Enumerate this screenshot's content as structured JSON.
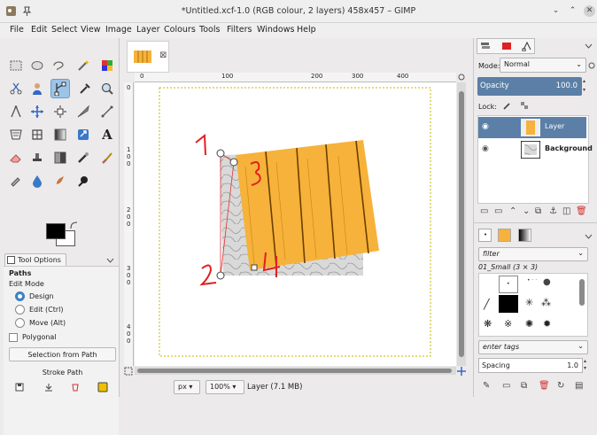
{
  "window": {
    "title": "*Untitled.xcf-1.0 (RGB colour, 2 layers) 458x457 – GIMP"
  },
  "menu": [
    "File",
    "Edit",
    "Select",
    "View",
    "Image",
    "Layer",
    "Colours",
    "Tools",
    "Filters",
    "Windows",
    "Help"
  ],
  "tool_options": {
    "tab_label": "Tool Options",
    "section": "Paths",
    "edit_mode_label": "Edit Mode",
    "modes": [
      "Design",
      "Edit (Ctrl)",
      "Move (Alt)"
    ],
    "polygonal_label": "Polygonal",
    "selection_button": "Selection from Path",
    "stroke_button": "Stroke Path"
  },
  "ruler": {
    "h_ticks": [
      "0",
      "100",
      "200",
      "300",
      "400"
    ],
    "v_ticks": [
      "0",
      "1",
      "0",
      "0",
      "2",
      "0",
      "0",
      "3",
      "0",
      "0",
      "4",
      "0",
      "0"
    ]
  },
  "annotations": [
    "1",
    "2",
    "3",
    "4"
  ],
  "status": {
    "unit": "px",
    "zoom": "100%",
    "layer_info": "Layer (7.1 MB)"
  },
  "layers_panel": {
    "mode_label": "Mode:",
    "mode_value": "Normal",
    "opacity_label": "Opacity",
    "opacity_value": "100.0",
    "lock_label": "Lock:",
    "layers": [
      {
        "name": "Layer",
        "selected": true
      },
      {
        "name": "Background",
        "selected": false
      }
    ]
  },
  "brushes_panel": {
    "filter_placeholder": "filter",
    "brush_name": "01_Small (3 × 3)",
    "tags_placeholder": "enter tags",
    "spacing_label": "Spacing",
    "spacing_value": "1.0"
  },
  "colors": {
    "accent": "#5b7fa6",
    "selection": "#9cc4e8",
    "annotation_red": "#e0201f",
    "wood": "#f6b23a"
  }
}
